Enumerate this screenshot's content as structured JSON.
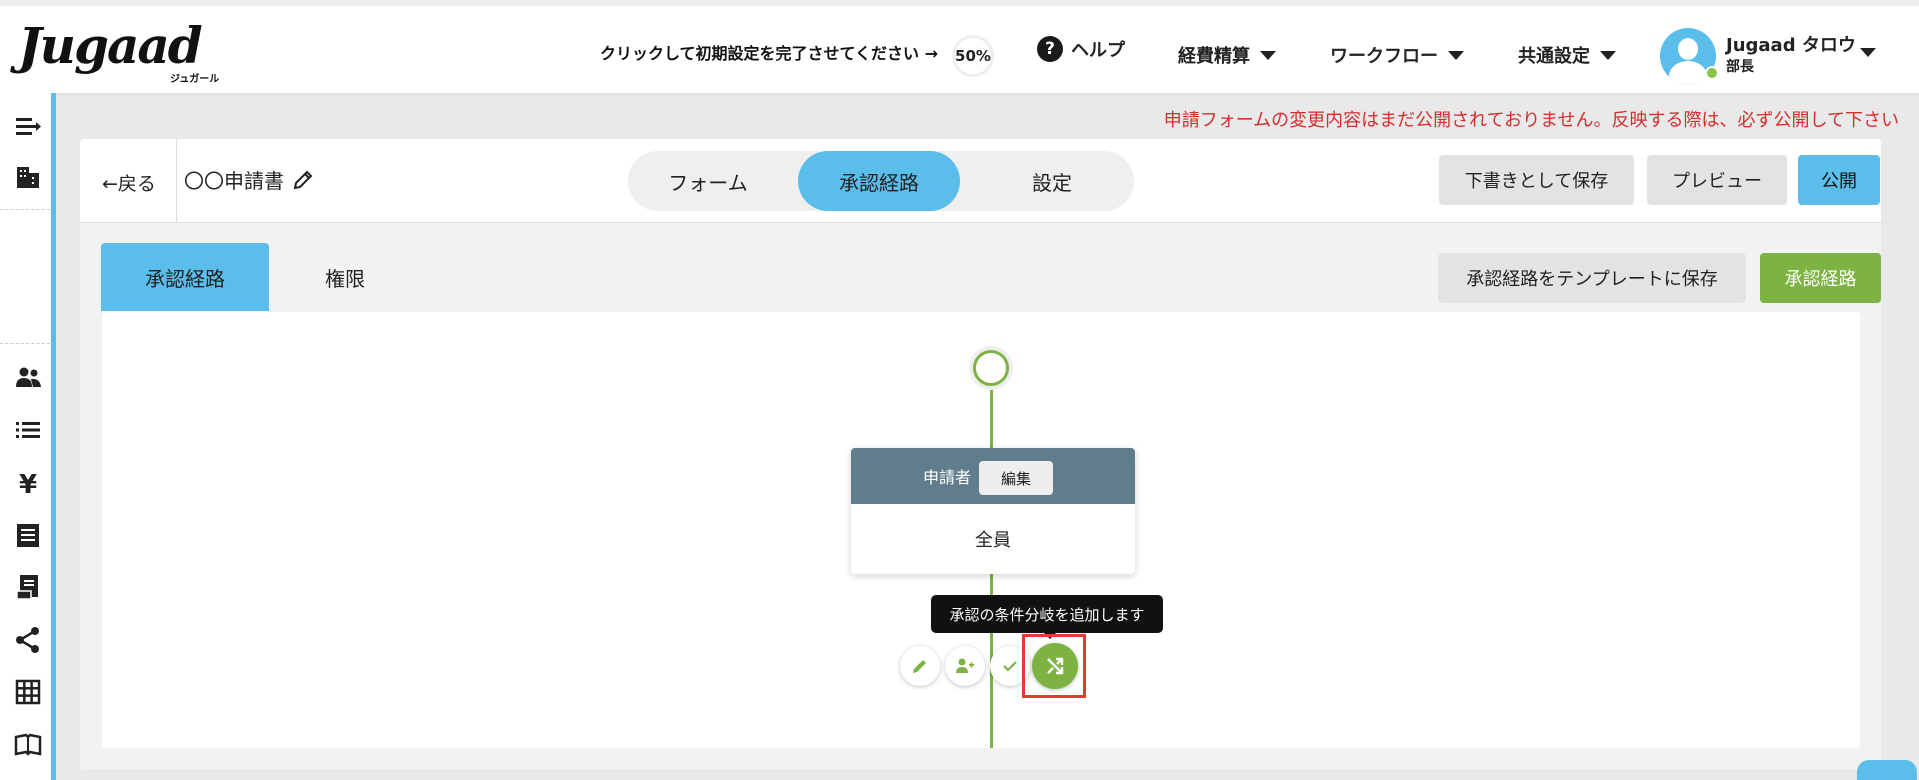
{
  "header": {
    "logo": "Jugaad",
    "logo_sub": "ジュガール",
    "setup_text": "クリックして初期設定を完了させてください →",
    "setup_percent": "50%",
    "help": "ヘルプ",
    "menu": [
      "経費精算",
      "ワークフロー",
      "共通設定"
    ],
    "user_name": "Jugaad タロウ",
    "user_role": "部長"
  },
  "banner": "申請フォームの変更内容はまだ公開されておりません。反映する際は、必ず公開して下さい",
  "editor": {
    "back": "戻る",
    "form_title": "〇〇申請書",
    "segments": [
      "フォーム",
      "承認経路",
      "設定"
    ],
    "active_segment": "承認経路",
    "save_draft": "下書きとして保存",
    "preview": "プレビュー",
    "publish": "公開"
  },
  "subtabs": {
    "tabs": [
      "承認経路",
      "権限"
    ],
    "save_template": "承認経路をテンプレートに保存",
    "route_button": "承認経路"
  },
  "flow": {
    "node_label": "申請者",
    "node_edit": "編集",
    "node_value": "全員",
    "tooltip": "承認の条件分岐を追加します"
  },
  "colors": {
    "accent_blue": "#5bbdea",
    "accent_green": "#7cb342",
    "node_header": "#607d8b",
    "warning_red": "#d32f2f"
  }
}
